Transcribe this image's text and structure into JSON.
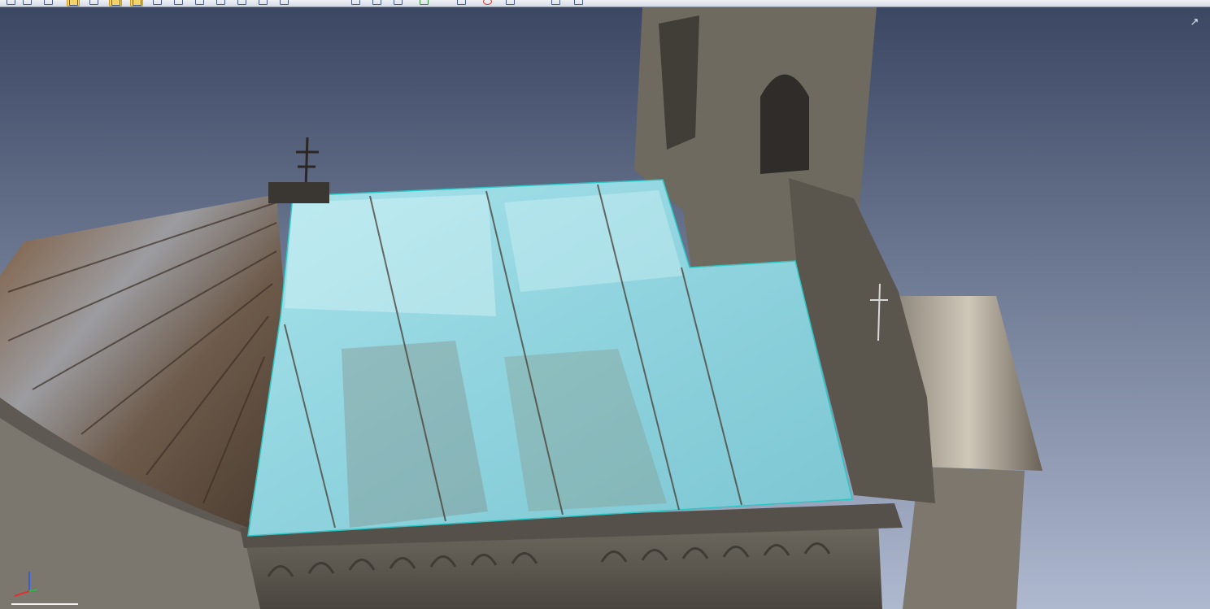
{
  "toolbar": {
    "buttons": [
      {
        "name": "axes-tool",
        "active": false
      },
      {
        "name": "star-tool",
        "active": false
      },
      {
        "name": "arrow-tool",
        "active": false
      },
      {
        "name": "display-mode-1",
        "active": true
      },
      {
        "name": "display-mode-2",
        "active": false
      },
      {
        "name": "display-mode-3",
        "active": true
      },
      {
        "name": "display-mode-4",
        "active": true
      },
      {
        "name": "view-1",
        "active": false
      },
      {
        "name": "view-2",
        "active": false
      },
      {
        "name": "view-3",
        "active": false
      },
      {
        "name": "view-4",
        "active": false
      },
      {
        "name": "view-5",
        "active": false
      },
      {
        "name": "view-6",
        "active": false
      },
      {
        "name": "view-7",
        "active": false
      },
      {
        "name": "grid-1",
        "active": false
      },
      {
        "name": "grid-2",
        "active": false
      },
      {
        "name": "grid-3",
        "active": false
      },
      {
        "name": "measure-tool",
        "active": false
      },
      {
        "name": "select-tool",
        "active": false
      },
      {
        "name": "stop-tool",
        "active": false
      },
      {
        "name": "clip-tool",
        "active": false
      },
      {
        "name": "capture-tool",
        "active": false
      },
      {
        "name": "settings-tool",
        "active": false
      }
    ]
  },
  "viewport": {
    "maximize_icon": "↗",
    "sky_top_color": "#3b4763",
    "sky_bottom_color": "#aeb8cf",
    "selection_color": "#8fd3de",
    "selection_outline_color": "#2cc7c4",
    "axis_colors": {
      "x": "#e03030",
      "y": "#2fb34a",
      "z": "#3a5de0"
    }
  }
}
